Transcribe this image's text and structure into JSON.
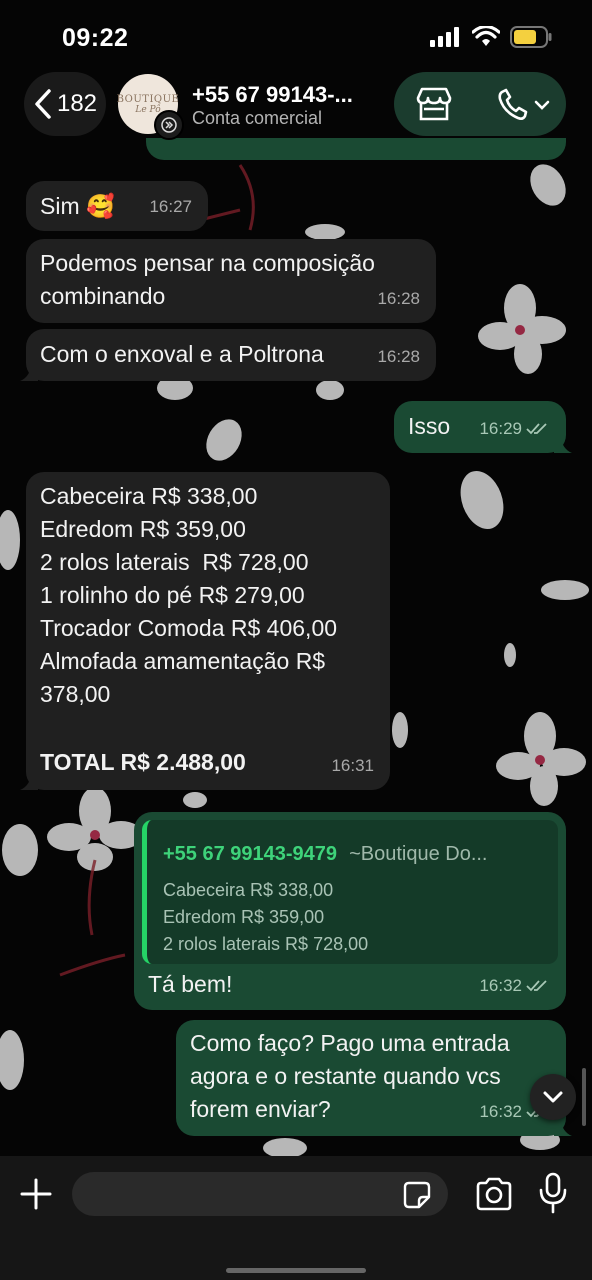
{
  "status_bar": {
    "time": "09:22"
  },
  "header": {
    "back_count": "182",
    "avatar_text_line1": "BOUTIQUE",
    "avatar_text_line2": "Le Pô",
    "contact_name": "+55 67 99143-...",
    "contact_subtitle": "Conta comercial"
  },
  "messages": [
    {
      "direction": "in",
      "text": "Sim 🥰",
      "time": "16:27"
    },
    {
      "direction": "in",
      "text": "Podemos pensar na composição\ncombinando",
      "time": "16:28"
    },
    {
      "direction": "in",
      "text": "Com o enxoval e a Poltrona",
      "time": "16:28"
    },
    {
      "direction": "out",
      "text": "Isso",
      "time": "16:29"
    },
    {
      "direction": "in",
      "text": "Cabeceira R$ 338,00\nEdredom R$ 359,00\n2 rolos laterais  R$ 728,00\n1 rolinho do pé R$ 279,00\nTrocador Comoda R$ 406,00\nAlmofada amamentação R$\n378,00",
      "total": "TOTAL R$ 2.488,00",
      "time": "16:31"
    },
    {
      "direction": "out",
      "quote": {
        "number": "+55 67 99143-9479",
        "name": "~Boutique Do...",
        "lines": [
          "Cabeceira R$ 338,00",
          "Edredom R$ 359,00",
          "2 rolos laterais  R$ 728,00"
        ]
      },
      "text": "Tá bem!",
      "time": "16:32"
    },
    {
      "direction": "out",
      "text": "Como faço? Pago uma entrada\nagora e o restante quando vcs\nforem enviar?",
      "time": "16:32"
    }
  ],
  "input": {
    "placeholder": ""
  },
  "colors": {
    "outgoing_bubble": "#1a4a33",
    "incoming_bubble": "#202020",
    "accent_green": "#25d366"
  }
}
